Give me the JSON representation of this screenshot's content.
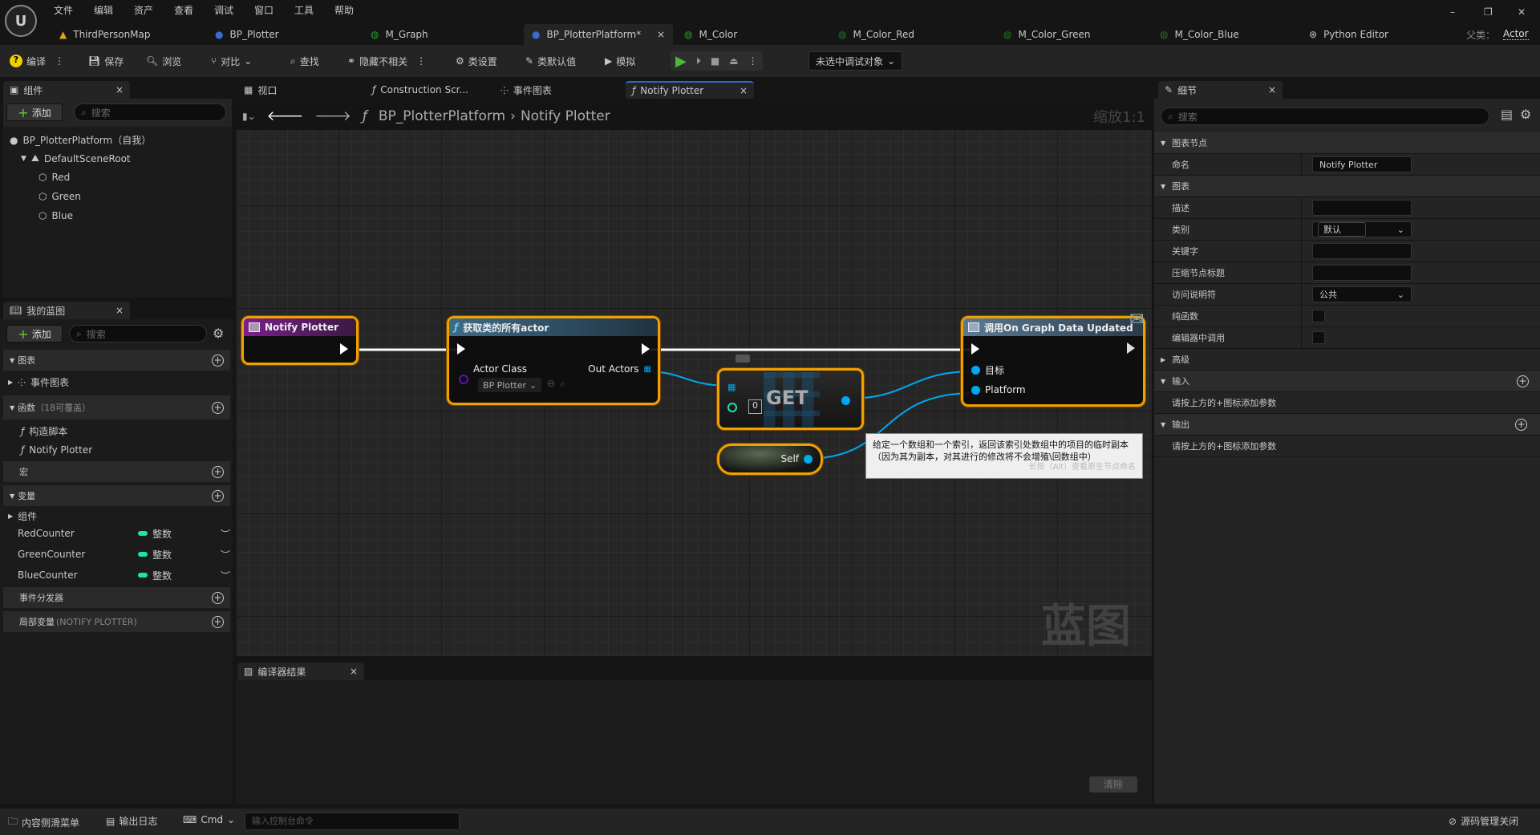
{
  "menu": [
    "文件",
    "编辑",
    "资产",
    "查看",
    "调试",
    "窗口",
    "工具",
    "帮助"
  ],
  "doc_tabs": [
    {
      "label": "ThirdPersonMap",
      "icon": "level-icon"
    },
    {
      "label": "BP_Plotter",
      "icon": "blueprint-icon"
    },
    {
      "label": "M_Graph",
      "icon": "material-icon"
    },
    {
      "label": "BP_PlotterPlatform*",
      "icon": "blueprint-icon",
      "active": true
    },
    {
      "label": "M_Color",
      "icon": "material-icon"
    },
    {
      "label": "M_Color_Red",
      "icon": "material-instance-icon"
    },
    {
      "label": "M_Color_Green",
      "icon": "material-instance-icon"
    },
    {
      "label": "M_Color_Blue",
      "icon": "material-instance-icon"
    },
    {
      "label": "Python Editor",
      "icon": "python-icon"
    }
  ],
  "parent_class": {
    "label": "父类：",
    "value": "Actor"
  },
  "window_controls": {
    "minimize": "–",
    "restore": "❐",
    "close": "✕"
  },
  "toolbar": {
    "compile": "编译",
    "save": "保存",
    "browse": "浏览",
    "diff": "对比",
    "find": "查找",
    "hide_unrelated": "隐藏不相关",
    "class_settings": "类设置",
    "class_defaults": "类默认值",
    "simulate": "模拟",
    "debug_target": "未选中调试对象"
  },
  "components": {
    "tab": "组件",
    "add": "添加",
    "search_placeholder": "搜索",
    "root": "BP_PlotterPlatform（自我）",
    "scene_root": "DefaultSceneRoot",
    "children": [
      "Red",
      "Green",
      "Blue"
    ]
  },
  "my_blueprint": {
    "tab": "我的蓝图",
    "add": "添加",
    "search_placeholder": "搜索",
    "graphs": "图表",
    "event_graph": "事件图表",
    "functions": "函数",
    "functions_note": "（18可覆盖）",
    "construction": "构造脚本",
    "notify": "Notify Plotter",
    "macros": "宏",
    "variables": "变量",
    "components": "组件",
    "vars": [
      {
        "name": "RedCounter",
        "type": "整数"
      },
      {
        "name": "GreenCounter",
        "type": "整数"
      },
      {
        "name": "BlueCounter",
        "type": "整数"
      }
    ],
    "dispatchers": "事件分发器",
    "local_vars": "局部变量",
    "local_vars_note": "(NOTIFY PLOTTER)"
  },
  "graph_tabs": [
    "视口",
    "Construction Scr...",
    "事件图表",
    "Notify Plotter"
  ],
  "breadcrumb": {
    "root": "BP_PlotterPlatform",
    "sep": "›",
    "current": "Notify Plotter",
    "zoom": "缩放1:1"
  },
  "nodes": {
    "entry": {
      "title": "Notify Plotter"
    },
    "get_all": {
      "title": "获取类的所有actor",
      "actor_class": "Actor Class",
      "class_value": "BP Plotter",
      "out": "Out Actors"
    },
    "get": {
      "title": "GET",
      "index": "0"
    },
    "self": {
      "label": "Self"
    },
    "call": {
      "title": "调用On Graph Data Updated",
      "target": "目标",
      "platform": "Platform"
    }
  },
  "tooltip": {
    "text": "给定一个数组和一个索引，返回该索引处数组中的项目的临时副本（因为其为副本，对其进行的修改将不会增殖\\回数组中）",
    "hint": "长按（Alt）查看原生节点命名"
  },
  "watermark": "蓝图",
  "compiler": {
    "tab": "编译器结果",
    "clear": "清除"
  },
  "details": {
    "tab": "细节",
    "search_placeholder": "搜索",
    "sec_node": "图表节点",
    "name_label": "命名",
    "name_value": "Notify Plotter",
    "sec_graph": "图表",
    "desc": "描述",
    "category": "类别",
    "category_value": "默认",
    "keywords": "关键字",
    "compact_title": "压缩节点标题",
    "access": "访问说明符",
    "access_value": "公共",
    "pure": "纯函数",
    "call_in_editor": "编辑器中调用",
    "pure_checked": false,
    "call_in_editor_checked": false,
    "advanced": "高级",
    "inputs": "输入",
    "inputs_hint": "请按上方的+图标添加参数",
    "outputs": "输出",
    "outputs_hint": "请按上方的+图标添加参数"
  },
  "statusbar": {
    "content_drawer": "内容侧滑菜单",
    "output_log": "输出日志",
    "cmd": "Cmd",
    "console_placeholder": "输入控制台命令",
    "source_control": "源码管理关闭"
  },
  "colors": {
    "accent_orange": "#f0a000",
    "exec_white": "#ffffff",
    "object_pin": "#00a8f0",
    "int_pin": "#1fe0b0",
    "class_pin": "#5a10c0",
    "entry_header": "#7a1f8f",
    "function_header": "#3f6a86"
  }
}
